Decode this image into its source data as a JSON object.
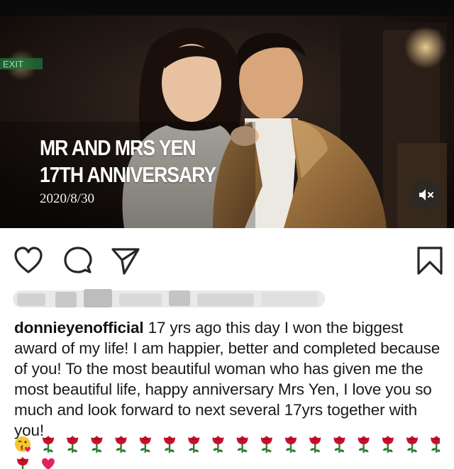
{
  "photo_overlay": {
    "title_line1": "MR AND MRS YEN",
    "title_line2": "17TH ANNIVERSARY",
    "date": "2020/8/30",
    "sign_text": "EXIT"
  },
  "actions": {
    "like_icon": "heart-icon",
    "comment_icon": "comment-icon",
    "share_icon": "send-icon",
    "save_icon": "bookmark-icon",
    "mute_icon": "speaker-muted-icon"
  },
  "caption": {
    "username": "donnieyenofficial",
    "text": " 17 yrs ago this day I won the biggest award of my life! I am happier, better and completed because of you! To the most beautiful woman who has given me the most beautiful life, happy anniversary Mrs Yen, I love you so much and look forward to next several 17yrs together with you!"
  },
  "emojis": {
    "kiss": "face-blowing-kiss",
    "rose": "rose",
    "heart": "red-heart",
    "rose_count": 17
  },
  "colors": {
    "text": "#1a1a1a",
    "icon_stroke": "#262626",
    "rose_red": "#c8102e",
    "stem_green": "#2e7d32"
  }
}
